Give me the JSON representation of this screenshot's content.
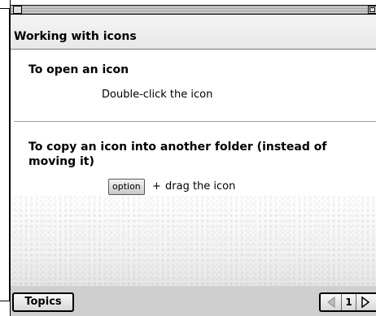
{
  "window": {
    "header_title": "Working with icons"
  },
  "sections": [
    {
      "title": "To open an icon",
      "instruction": "Double-click the icon"
    },
    {
      "title_line1": "To copy an icon into another folder (instead of",
      "title_line2": "moving it)",
      "key_label": "option",
      "plus": "+",
      "instruction": "drag the icon"
    }
  ],
  "footer": {
    "topics_label": "Topics",
    "page_number": "1"
  }
}
